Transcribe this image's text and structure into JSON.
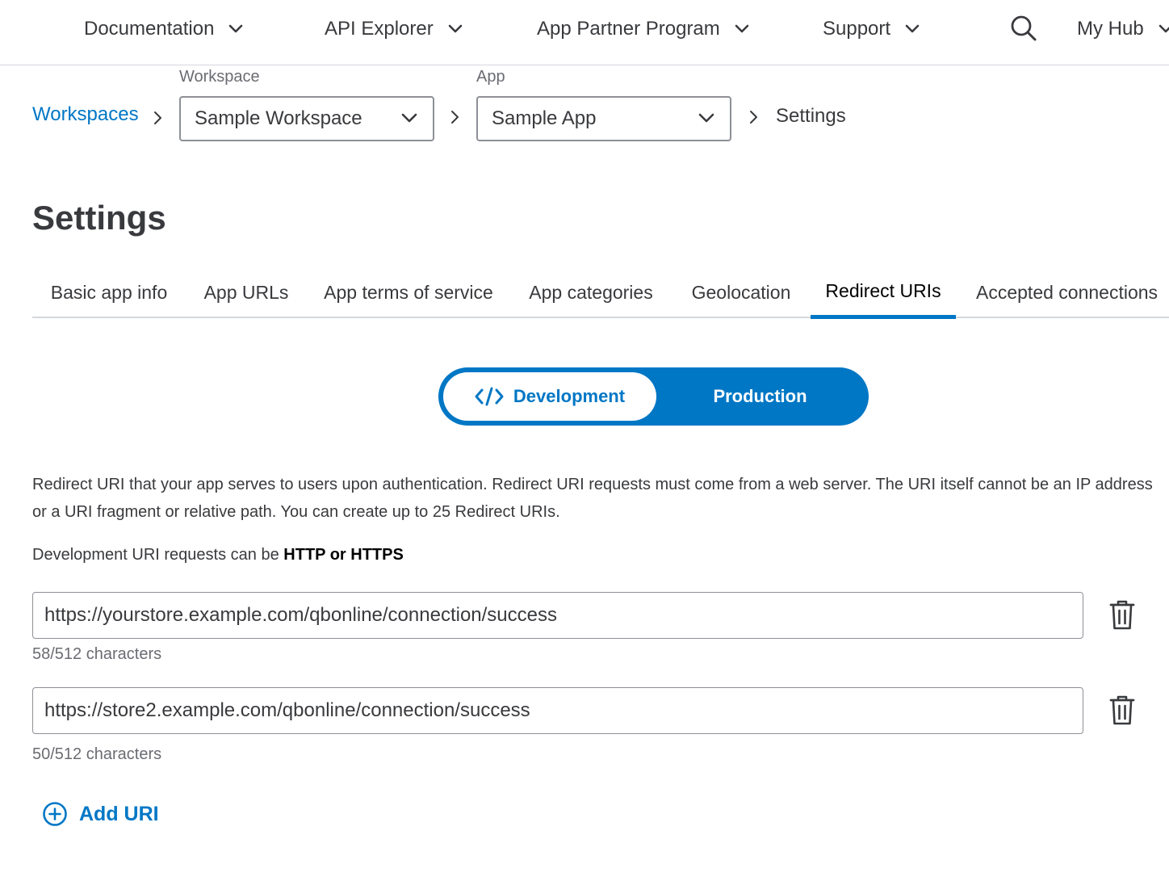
{
  "topnav": {
    "items": [
      {
        "label": "Documentation"
      },
      {
        "label": "API Explorer"
      },
      {
        "label": "App Partner Program"
      },
      {
        "label": "Support"
      }
    ],
    "my_hub": "My Hub"
  },
  "breadcrumb": {
    "workspaces_link": "Workspaces",
    "workspace_label": "Workspace",
    "workspace_value": "Sample Workspace",
    "app_label": "App",
    "app_value": "Sample App",
    "current": "Settings"
  },
  "page_title": "Settings",
  "tabs": [
    {
      "label": "Basic app info",
      "active": false
    },
    {
      "label": "App URLs",
      "active": false
    },
    {
      "label": "App terms of service",
      "active": false
    },
    {
      "label": "App categories",
      "active": false
    },
    {
      "label": "Geolocation",
      "active": false
    },
    {
      "label": "Redirect URIs",
      "active": true
    },
    {
      "label": "Accepted connections",
      "active": false
    }
  ],
  "environment_toggle": {
    "development": "Development",
    "production": "Production",
    "selected": "Development"
  },
  "description": "Redirect URI that your app serves to users upon authentication. Redirect URI requests must come from a web server. The URI itself cannot be an IP address or a URI fragment or relative path. You can create up to 25 Redirect URIs.",
  "protocol_note": {
    "prefix": "Development URI requests can be ",
    "emphasis": "HTTP or HTTPS"
  },
  "redirect_uris": [
    {
      "value": "https://yourstore.example.com/qbonline/connection/success",
      "count": "58/512 characters"
    },
    {
      "value": "https://store2.example.com/qbonline/connection/success",
      "count": "50/512 characters"
    }
  ],
  "add_uri_label": "Add URI",
  "colors": {
    "accent": "#0077c5",
    "text": "#393a3d",
    "muted": "#6b6c72",
    "border": "#8d9096"
  }
}
